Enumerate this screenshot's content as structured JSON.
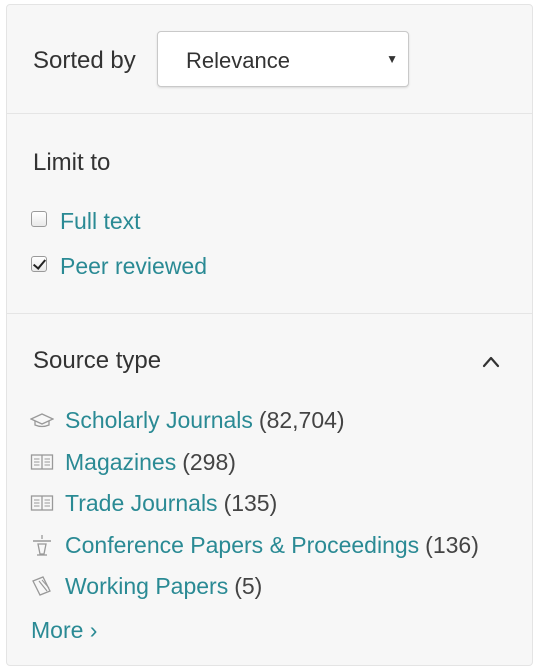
{
  "sort": {
    "label": "Sorted by",
    "selected": "Relevance"
  },
  "limit": {
    "heading": "Limit to",
    "options": [
      {
        "label": "Full text",
        "checked": false
      },
      {
        "label": "Peer reviewed",
        "checked": true
      }
    ]
  },
  "source_type": {
    "heading": "Source type",
    "items": [
      {
        "label": "Scholarly Journals",
        "count": "(82,704)",
        "icon": "mortarboard-icon"
      },
      {
        "label": "Magazines",
        "count": "(298)",
        "icon": "open-book-icon"
      },
      {
        "label": "Trade Journals",
        "count": "(135)",
        "icon": "open-book-icon"
      },
      {
        "label": "Conference Papers & Proceedings",
        "count": "(136)",
        "icon": "podium-icon"
      },
      {
        "label": "Working Papers",
        "count": "(5)",
        "icon": "pencil-paper-icon"
      }
    ],
    "more_label": "More ›"
  },
  "colors": {
    "link": "#2a8a94",
    "panel_bg": "#f7f7f7",
    "text": "#333333"
  }
}
